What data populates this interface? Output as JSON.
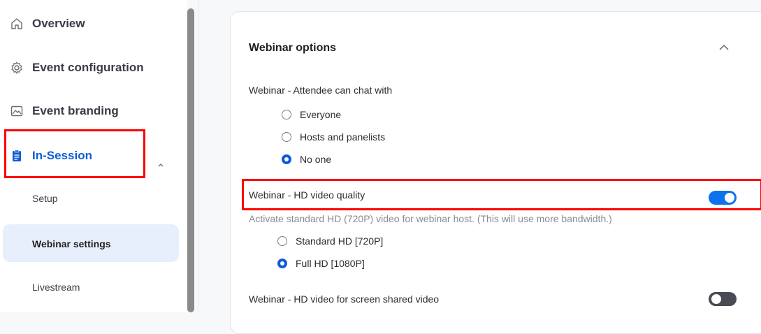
{
  "sidebar": {
    "items": [
      {
        "label": "Overview",
        "icon": "home-icon"
      },
      {
        "label": "Event configuration",
        "icon": "gear-icon"
      },
      {
        "label": "Event branding",
        "icon": "image-icon"
      },
      {
        "label": "In-Session",
        "icon": "clipboard-icon"
      }
    ],
    "sub_items": [
      {
        "label": "Setup"
      },
      {
        "label": "Webinar settings"
      },
      {
        "label": "Livestream"
      }
    ]
  },
  "panel": {
    "title": "Webinar options",
    "chat": {
      "label": "Webinar - Attendee can chat with",
      "options": [
        "Everyone",
        "Hosts and panelists",
        "No one"
      ],
      "selected": "No one"
    },
    "hd_video": {
      "label": "Webinar - HD video quality",
      "description": "Activate standard HD (720P) video for webinar host. (This will use more bandwidth.)",
      "enabled": true,
      "options": [
        "Standard HD [720P]",
        "Full HD [1080P]"
      ],
      "selected": "Full HD [1080P]"
    },
    "hd_screen_share": {
      "label": "Webinar - HD video for screen shared video",
      "enabled": false
    }
  },
  "colors": {
    "accent": "#0e5bd8",
    "highlight": "#ff0000",
    "selected_bg": "#e8effc"
  }
}
